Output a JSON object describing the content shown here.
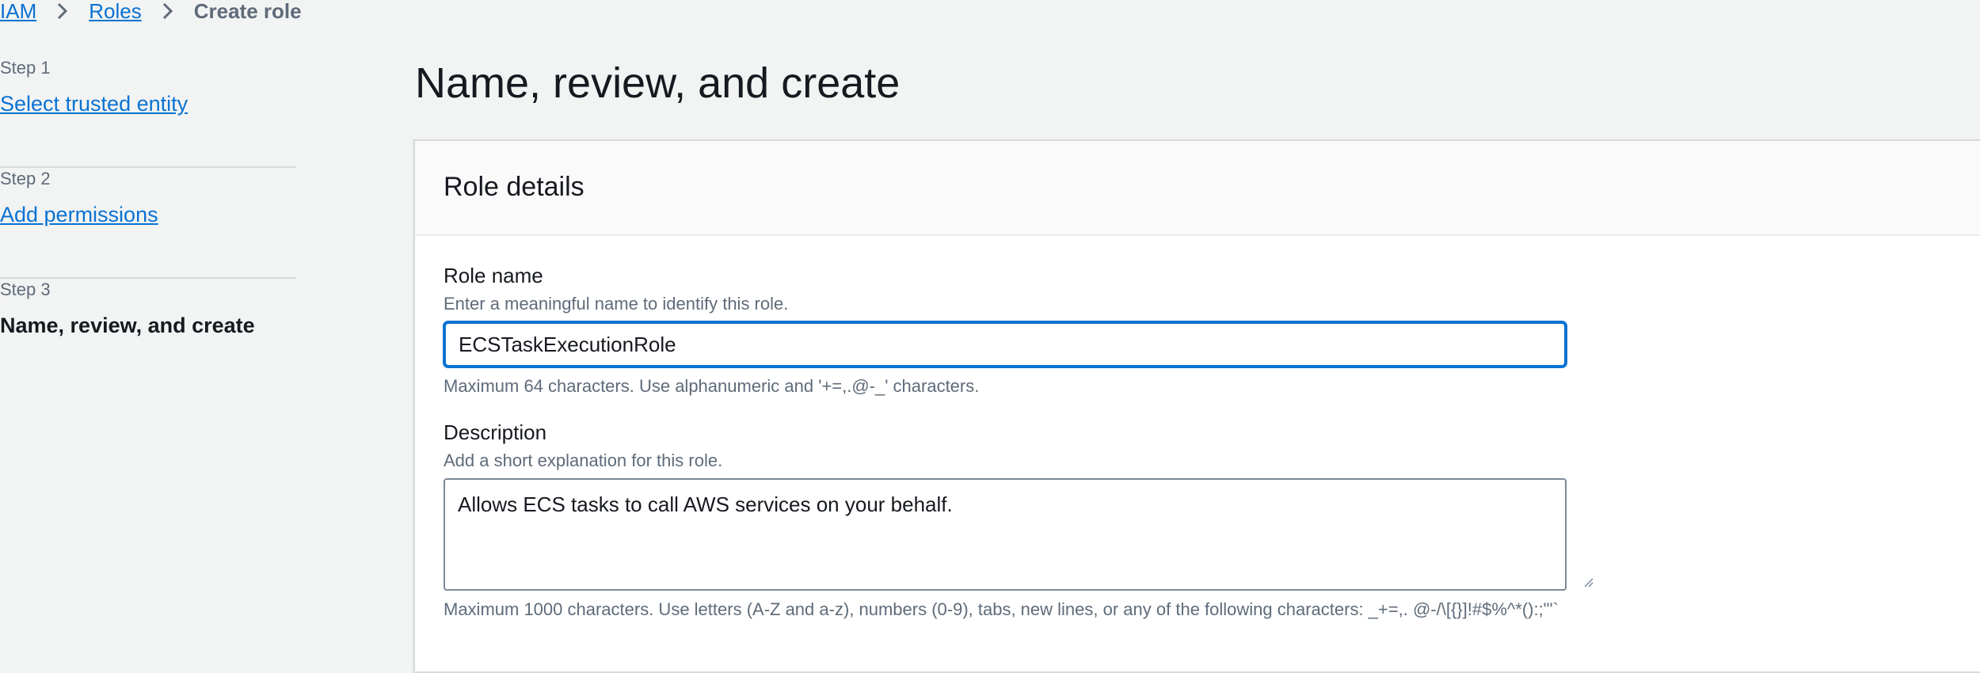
{
  "breadcrumb": {
    "items": [
      "IAM",
      "Roles"
    ],
    "current": "Create role"
  },
  "steps": [
    {
      "step": "Step 1",
      "title": "Select trusted entity"
    },
    {
      "step": "Step 2",
      "title": "Add permissions"
    },
    {
      "step": "Step 3",
      "title": "Name, review, and create"
    }
  ],
  "page": {
    "title": "Name, review, and create"
  },
  "role_details": {
    "title": "Role details",
    "role_name": {
      "label": "Role name",
      "description": "Enter a meaningful name to identify this role.",
      "value": "ECSTaskExecutionRole",
      "constraint": "Maximum 64 characters. Use alphanumeric and '+=,.@-_' characters."
    },
    "description": {
      "label": "Description",
      "description": "Add a short explanation for this role.",
      "value": "Allows ECS tasks to call AWS services on your behalf.",
      "constraint": "Maximum 1000 characters. Use letters (A-Z and a-z), numbers (0-9), tabs, new lines, or any of the following characters: _+=,. @-/\\[{}]!#$%^*():;\"'`"
    }
  },
  "colors": {
    "link": "#0972d3",
    "background": "#f2f3f3",
    "focus_border": "#0972d3"
  }
}
